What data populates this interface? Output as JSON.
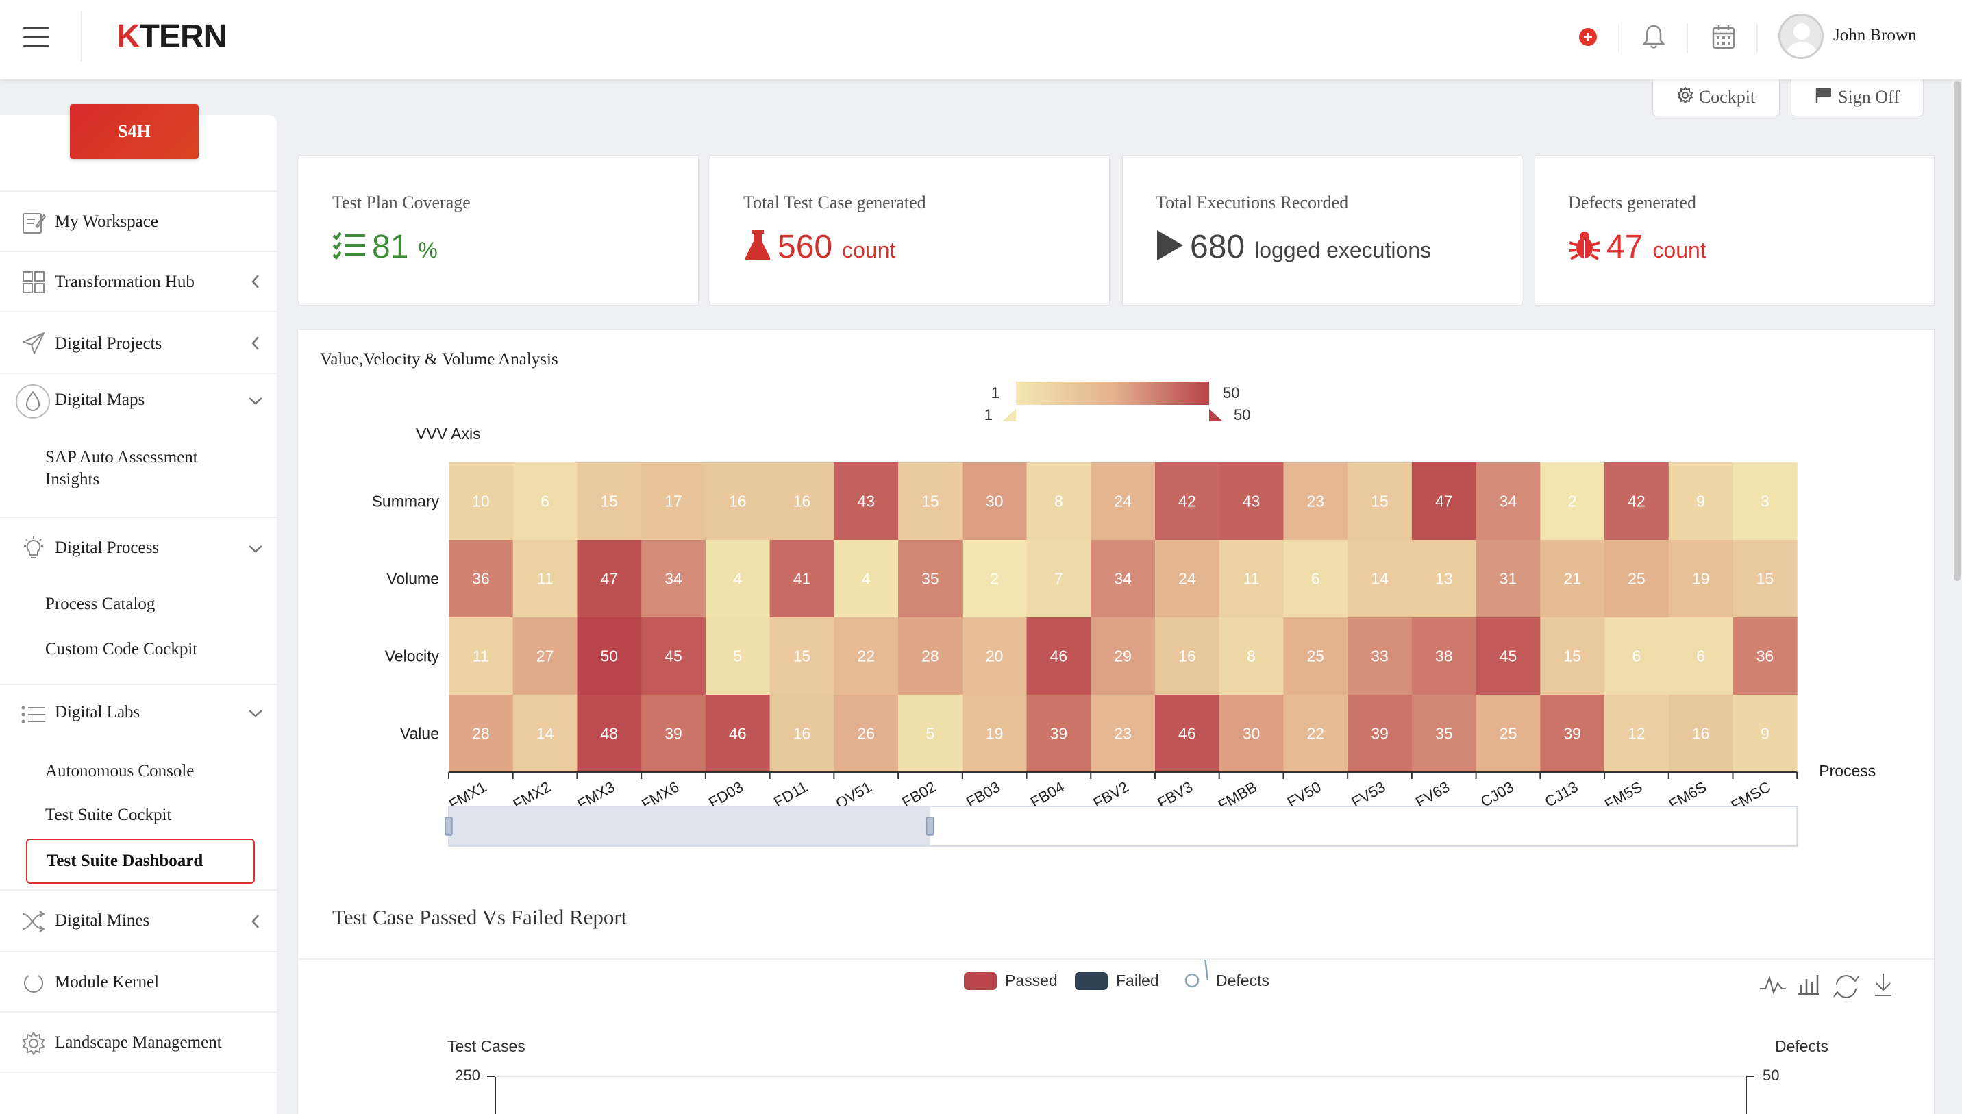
{
  "header": {
    "logo_k": "K",
    "logo_rest": "TERN",
    "user_name": "John Brown",
    "icons": [
      "add-circle-icon",
      "bell-icon",
      "calendar-icon"
    ]
  },
  "sidebar": {
    "badge": "S4H",
    "items": [
      {
        "label": "My Workspace",
        "icon": "edit-icon"
      },
      {
        "label": "Transformation Hub",
        "icon": "grid-icon"
      },
      {
        "label": "Digital Projects",
        "icon": "send-icon"
      },
      {
        "label": "Digital Maps",
        "icon": "drop-icon"
      },
      {
        "label": "Digital Process",
        "icon": "bulb-icon"
      },
      {
        "label": "Digital Labs",
        "icon": "list-icon"
      },
      {
        "label": "Digital Mines",
        "icon": "shuffle-icon"
      },
      {
        "label": "Module Kernel",
        "icon": "power-icon"
      },
      {
        "label": "Landscape Management",
        "icon": "gear-icon"
      }
    ],
    "sub_maps": [
      "SAP Auto Assessment",
      "Insights"
    ],
    "sub_process": [
      "Process Catalog",
      "Custom Code Cockpit"
    ],
    "sub_labs": [
      "Autonomous Console",
      "Test Suite Cockpit",
      "Test Suite Dashboard"
    ]
  },
  "actions": {
    "cockpit": "Cockpit",
    "signoff": "Sign Off"
  },
  "kpis": [
    {
      "title": "Test Plan Coverage",
      "value": "81",
      "unit": "%",
      "color": "#3d8b37",
      "icon": "checklist-icon"
    },
    {
      "title": "Total Test Case generated",
      "value": "560",
      "unit": "count",
      "color": "#d2322d",
      "icon": "flask-icon"
    },
    {
      "title": "Total Executions Recorded",
      "value": "680",
      "unit": "logged executions",
      "color": "#444444",
      "icon": "play-icon"
    },
    {
      "title": "Defects generated",
      "value": "47",
      "unit": "count",
      "color": "#e03030",
      "icon": "bug-icon"
    }
  ],
  "heatmap_title": "Value,Velocity & Volume Analysis",
  "report_title": "Test Case Passed Vs Failed Report",
  "chart_data": [
    {
      "type": "heatmap",
      "ylabel": "VVV Axis",
      "xlabel": "Process",
      "visual_map": {
        "min": 1,
        "max": 50,
        "min_label": "1",
        "max_label": "50",
        "colors": [
          "#f3e7b1",
          "#e3b28f",
          "#b8434a"
        ]
      },
      "x": [
        "FMX1",
        "FMX2",
        "FMX3",
        "FMX6",
        "FD03",
        "FD11",
        "OV51",
        "FB02",
        "FB03",
        "FB04",
        "FBV2",
        "FBV3",
        "FMBB",
        "FV50",
        "FV53",
        "FV63",
        "CJ03",
        "CJ13",
        "FM5S",
        "FM6S",
        "FMSC"
      ],
      "y": [
        "Summary",
        "Volume",
        "Velocity",
        "Value"
      ],
      "values": [
        [
          10,
          6,
          15,
          17,
          16,
          16,
          43,
          15,
          30,
          8,
          24,
          42,
          43,
          23,
          15,
          47,
          34,
          2,
          42,
          9,
          3
        ],
        [
          36,
          11,
          47,
          34,
          4,
          41,
          4,
          35,
          2,
          7,
          34,
          24,
          11,
          6,
          14,
          13,
          31,
          21,
          25,
          19,
          15
        ],
        [
          11,
          27,
          50,
          45,
          5,
          15,
          22,
          28,
          20,
          46,
          29,
          16,
          8,
          25,
          33,
          38,
          45,
          15,
          6,
          6,
          36
        ],
        [
          28,
          14,
          48,
          39,
          46,
          16,
          26,
          5,
          19,
          39,
          23,
          46,
          30,
          22,
          39,
          35,
          25,
          39,
          12,
          16,
          9
        ]
      ]
    },
    {
      "type": "bar",
      "title": "",
      "series": [
        {
          "name": "Passed",
          "color": "#b8434a"
        },
        {
          "name": "Failed",
          "color": "#2f4356"
        },
        {
          "name": "Defects",
          "color": "#8aa4b4"
        }
      ],
      "ylabel": "Test Cases",
      "y2label": "Defects",
      "ylim": [
        0,
        250
      ],
      "y2lim": [
        0,
        50
      ],
      "y_top_tick": "250",
      "y2_top_tick": "50"
    }
  ]
}
